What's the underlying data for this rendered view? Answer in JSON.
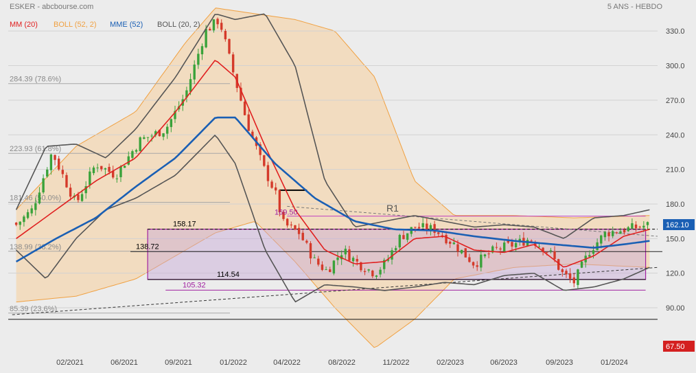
{
  "header": {
    "title": "ESKER - abcbourse.com",
    "period": "5 ANS - HEBDO"
  },
  "legend": [
    {
      "label": "MM (20)",
      "color": "#e02020"
    },
    {
      "label": "BOLL (52, 2)",
      "color": "#f0a040"
    },
    {
      "label": "MME (52)",
      "color": "#1a5fb4"
    },
    {
      "label": "BOLL (20, 2)",
      "color": "#555555"
    }
  ],
  "chart_data": {
    "type": "candlestick",
    "x_tick_labels": [
      "02/2021",
      "06/2021",
      "09/2021",
      "01/2022",
      "04/2022",
      "08/2022",
      "11/2022",
      "02/2023",
      "06/2023",
      "09/2023",
      "01/2024"
    ],
    "y_ticks": [
      90.0,
      120.0,
      150.0,
      180.0,
      210.0,
      240.0,
      270.0,
      300.0,
      330.0
    ],
    "y_tick_labels": [
      "90.00",
      "120.0",
      "150.0",
      "180.0",
      "210.0",
      "240.0",
      "270.0",
      "300.0",
      "330.0"
    ],
    "ylim": [
      65,
      345
    ],
    "grid": "horizontal",
    "last_price": 162.1,
    "last_price_label": "162.10",
    "low_marker_label": "67.50",
    "fibonacci_levels": [
      {
        "value": 284.39,
        "label": "284.39  (78.6%)"
      },
      {
        "value": 223.93,
        "label": "223.93  (61.8%)"
      },
      {
        "value": 181.46,
        "label": "181.46  (50.0%)"
      },
      {
        "value": 138.99,
        "label": "138.99  (38.2%)"
      },
      {
        "value": 85.39,
        "label": "85.39  (23.6%)"
      }
    ],
    "annotations": [
      {
        "text": "158.17",
        "value": 158.17,
        "color": "#000000"
      },
      {
        "text": "138.72",
        "value": 138.72,
        "color": "#000000"
      },
      {
        "text": "114.54",
        "value": 114.54,
        "color": "#000000"
      },
      {
        "text": "105.32",
        "value": 105.32,
        "color": "#a020a0"
      },
      {
        "text": "169.50",
        "value": 169.5,
        "color": "#a020a0"
      },
      {
        "text": "R1",
        "color": "#555555"
      }
    ],
    "series": [
      {
        "name": "MM (20)",
        "kind": "moving average",
        "color": "#e02020"
      },
      {
        "name": "MME (52)",
        "kind": "exponential moving average",
        "color": "#1a5fb4"
      },
      {
        "name": "BOLL (52, 2)",
        "kind": "bollinger band",
        "color": "#f0a040"
      },
      {
        "name": "BOLL (20, 2)",
        "kind": "bollinger band",
        "color": "#555555"
      }
    ],
    "close_path": [
      [
        2021.0,
        162
      ],
      [
        2021.08,
        175
      ],
      [
        2021.18,
        225
      ],
      [
        2021.3,
        180
      ],
      [
        2021.4,
        215
      ],
      [
        2021.5,
        205
      ],
      [
        2021.62,
        235
      ],
      [
        2021.75,
        245
      ],
      [
        2021.85,
        275
      ],
      [
        2021.95,
        330
      ],
      [
        2022.02,
        340
      ],
      [
        2022.08,
        300
      ],
      [
        2022.16,
        250
      ],
      [
        2022.24,
        212
      ],
      [
        2022.3,
        190
      ],
      [
        2022.34,
        163
      ],
      [
        2022.42,
        155
      ],
      [
        2022.5,
        130
      ],
      [
        2022.56,
        122
      ],
      [
        2022.64,
        140
      ],
      [
        2022.72,
        128
      ],
      [
        2022.8,
        120
      ],
      [
        2022.86,
        130
      ],
      [
        2022.92,
        150
      ],
      [
        2023.0,
        160
      ],
      [
        2023.1,
        158
      ],
      [
        2023.2,
        145
      ],
      [
        2023.3,
        128
      ],
      [
        2023.4,
        140
      ],
      [
        2023.5,
        145
      ],
      [
        2023.58,
        150
      ],
      [
        2023.68,
        138
      ],
      [
        2023.74,
        120
      ],
      [
        2023.8,
        112
      ],
      [
        2023.88,
        140
      ],
      [
        2023.96,
        155
      ],
      [
        2024.06,
        158
      ],
      [
        2024.18,
        162
      ]
    ],
    "ma20_path": [
      [
        2021.0,
        150
      ],
      [
        2021.2,
        175
      ],
      [
        2021.4,
        200
      ],
      [
        2021.6,
        220
      ],
      [
        2021.8,
        260
      ],
      [
        2022.0,
        305
      ],
      [
        2022.1,
        290
      ],
      [
        2022.25,
        230
      ],
      [
        2022.4,
        175
      ],
      [
        2022.55,
        140
      ],
      [
        2022.7,
        128
      ],
      [
        2022.85,
        130
      ],
      [
        2023.0,
        150
      ],
      [
        2023.15,
        152
      ],
      [
        2023.3,
        140
      ],
      [
        2023.45,
        138
      ],
      [
        2023.6,
        145
      ],
      [
        2023.75,
        125
      ],
      [
        2023.9,
        135
      ],
      [
        2024.05,
        152
      ],
      [
        2024.18,
        158
      ]
    ],
    "mme52_path": [
      [
        2021.0,
        130
      ],
      [
        2021.2,
        150
      ],
      [
        2021.4,
        168
      ],
      [
        2021.6,
        195
      ],
      [
        2021.8,
        220
      ],
      [
        2022.0,
        255
      ],
      [
        2022.1,
        255
      ],
      [
        2022.3,
        215
      ],
      [
        2022.5,
        185
      ],
      [
        2022.7,
        165
      ],
      [
        2022.9,
        158
      ],
      [
        2023.1,
        157
      ],
      [
        2023.3,
        152
      ],
      [
        2023.5,
        148
      ],
      [
        2023.7,
        145
      ],
      [
        2023.9,
        142
      ],
      [
        2024.05,
        145
      ],
      [
        2024.18,
        148
      ]
    ],
    "boll52_upper": [
      [
        2021.0,
        175
      ],
      [
        2021.3,
        230
      ],
      [
        2021.6,
        260
      ],
      [
        2021.85,
        320
      ],
      [
        2022.0,
        350
      ],
      [
        2022.2,
        345
      ],
      [
        2022.4,
        340
      ],
      [
        2022.6,
        330
      ],
      [
        2022.8,
        290
      ],
      [
        2023.0,
        200
      ],
      [
        2023.2,
        170
      ],
      [
        2023.5,
        170
      ],
      [
        2023.8,
        168
      ],
      [
        2024.18,
        170
      ]
    ],
    "boll52_lower": [
      [
        2021.0,
        95
      ],
      [
        2021.3,
        100
      ],
      [
        2021.6,
        115
      ],
      [
        2021.85,
        140
      ],
      [
        2022.0,
        155
      ],
      [
        2022.2,
        165
      ],
      [
        2022.4,
        130
      ],
      [
        2022.6,
        90
      ],
      [
        2022.8,
        55
      ],
      [
        2023.0,
        80
      ],
      [
        2023.2,
        115
      ],
      [
        2023.5,
        125
      ],
      [
        2023.8,
        128
      ],
      [
        2024.18,
        125
      ]
    ],
    "boll20_upper": [
      [
        2021.0,
        175
      ],
      [
        2021.15,
        230
      ],
      [
        2021.3,
        232
      ],
      [
        2021.45,
        220
      ],
      [
        2021.6,
        245
      ],
      [
        2021.8,
        290
      ],
      [
        2022.0,
        345
      ],
      [
        2022.1,
        340
      ],
      [
        2022.25,
        345
      ],
      [
        2022.4,
        300
      ],
      [
        2022.55,
        200
      ],
      [
        2022.7,
        160
      ],
      [
        2022.85,
        165
      ],
      [
        2023.0,
        170
      ],
      [
        2023.15,
        165
      ],
      [
        2023.3,
        160
      ],
      [
        2023.45,
        162
      ],
      [
        2023.6,
        160
      ],
      [
        2023.75,
        150
      ],
      [
        2023.9,
        168
      ],
      [
        2024.05,
        170
      ],
      [
        2024.18,
        175
      ]
    ],
    "boll20_lower": [
      [
        2021.0,
        140
      ],
      [
        2021.15,
        115
      ],
      [
        2021.3,
        150
      ],
      [
        2021.45,
        175
      ],
      [
        2021.6,
        185
      ],
      [
        2021.8,
        205
      ],
      [
        2022.0,
        240
      ],
      [
        2022.1,
        215
      ],
      [
        2022.25,
        140
      ],
      [
        2022.4,
        95
      ],
      [
        2022.55,
        110
      ],
      [
        2022.7,
        108
      ],
      [
        2022.85,
        105
      ],
      [
        2023.0,
        108
      ],
      [
        2023.15,
        112
      ],
      [
        2023.3,
        110
      ],
      [
        2023.45,
        118
      ],
      [
        2023.6,
        120
      ],
      [
        2023.75,
        105
      ],
      [
        2023.9,
        108
      ],
      [
        2024.05,
        115
      ],
      [
        2024.18,
        125
      ]
    ]
  }
}
